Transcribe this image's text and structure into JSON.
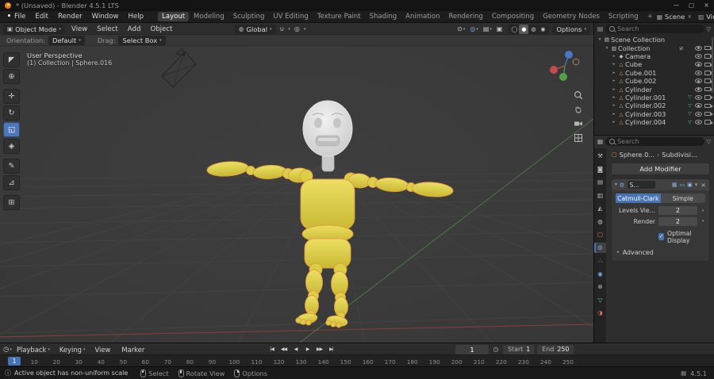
{
  "ui": {
    "dd": "▾"
  },
  "titlebar": {
    "title": "* (Unsaved) - Blender 4.5.1 LTS",
    "minimize": "—",
    "maximize": "▢",
    "close": "×"
  },
  "menus": [
    {
      "label": "File"
    },
    {
      "label": "Edit"
    },
    {
      "label": "Render"
    },
    {
      "label": "Window"
    },
    {
      "label": "Help"
    }
  ],
  "workspaces": [
    {
      "label": "Layout",
      "active": 1
    },
    {
      "label": "Modeling"
    },
    {
      "label": "Sculpting"
    },
    {
      "label": "UV Editing"
    },
    {
      "label": "Texture Paint"
    },
    {
      "label": "Shading"
    },
    {
      "label": "Animation"
    },
    {
      "label": "Rendering"
    },
    {
      "label": "Compositing"
    },
    {
      "label": "Geometry Nodes"
    },
    {
      "label": "Scripting"
    },
    {
      "label": "+",
      "add": 1
    }
  ],
  "scene_selector": {
    "scene_icon": "▦",
    "scene_label": "Scene",
    "viewlayer_icon": "▥",
    "viewlayer_label": "ViewLayer",
    "close": "×"
  },
  "viewhdr": {
    "mode_icon": "▣",
    "mode": "Object Mode",
    "menus": [
      {
        "label": "View"
      },
      {
        "label": "Select"
      },
      {
        "label": "Add"
      },
      {
        "label": "Object"
      }
    ],
    "orientation_icon": "◍",
    "orientation": "Global",
    "snap_icon": "∪",
    "prop_icon": "◎",
    "right_icons": [
      {
        "name": "visibility",
        "glyph": "⊙",
        "dd_glyph": "▾"
      },
      {
        "name": "gizmos",
        "glyph": "◎",
        "dd_glyph": "▾",
        "active": 1
      },
      {
        "name": "overlays",
        "glyph": "▤",
        "dd_glyph": "▾"
      },
      {
        "name": "xray",
        "glyph": "▣"
      }
    ],
    "shading": [
      {
        "name": "wireframe",
        "glyph": "◯"
      },
      {
        "name": "solid",
        "glyph": "●",
        "active": 1
      },
      {
        "name": "material-preview",
        "glyph": "◍"
      },
      {
        "name": "rendered",
        "glyph": "◉"
      }
    ],
    "options": "Options"
  },
  "toolstrip": {
    "orientation_label": "Orientation:",
    "orientation_value": "Default",
    "drag_label": "Drag:",
    "drag_value": "Select Box"
  },
  "viewport": {
    "overlay1": "User Perspective",
    "overlay2": "(1) Collection | Sphere.016",
    "tools": [
      {
        "name": "tweak-select-tool",
        "glyph": "◤"
      },
      {
        "name": "cursor-tool",
        "glyph": "⊕"
      },
      {
        "name": "move-tool",
        "glyph": "✛",
        "gap": 1
      },
      {
        "name": "rotate-tool",
        "glyph": "↻"
      },
      {
        "name": "scale-tool",
        "glyph": "◱",
        "active": 1
      },
      {
        "name": "transform-tool",
        "glyph": "◈"
      },
      {
        "name": "annotate-tool",
        "glyph": "✎",
        "gap": 1
      },
      {
        "name": "measure-tool",
        "glyph": "⊿"
      },
      {
        "name": "add-cube-tool",
        "glyph": "⊞",
        "gap": 1
      }
    ]
  },
  "outliner": {
    "mode_icon": "▤",
    "search_placeholder": "Search",
    "filter_icon": "▽",
    "rows": [
      {
        "name": "Scene Collection",
        "arrow": "▾",
        "icon_glyph": "▤",
        "icon_color": "#cfcfcf",
        "indent": 0,
        "hide_restrict": 1
      },
      {
        "name": "Collection",
        "arrow": "▾",
        "icon_glyph": "▥",
        "icon_color": "#cfcfcf",
        "indent": 1,
        "check": 1,
        "check_glyph": "✓"
      },
      {
        "name": "Camera",
        "arrow": "▸",
        "icon_glyph": "◆",
        "icon_color": "#b9b9b9",
        "indent": 2
      },
      {
        "name": "Cube",
        "arrow": "▸",
        "icon_glyph": "△",
        "icon_color": "#e09a5c",
        "indent": 2
      },
      {
        "name": "Cube.001",
        "arrow": "▸",
        "icon_glyph": "△",
        "icon_color": "#e09a5c",
        "indent": 2
      },
      {
        "name": "Cube.002",
        "arrow": "▸",
        "icon_glyph": "△",
        "icon_color": "#e09a5c",
        "indent": 2
      },
      {
        "name": "Cylinder",
        "arrow": "▸",
        "icon_glyph": "△",
        "icon_color": "#e09a5c",
        "indent": 2
      },
      {
        "name": "Cylinder.001",
        "arrow": "▸",
        "icon_glyph": "△",
        "icon_color": "#e09a5c",
        "indent": 2,
        "mod_glyph": "▽"
      },
      {
        "name": "Cylinder.002",
        "arrow": "▸",
        "icon_glyph": "△",
        "icon_color": "#e09a5c",
        "indent": 2,
        "mod_glyph": "▽"
      },
      {
        "name": "Cylinder.003",
        "arrow": "▸",
        "icon_glyph": "△",
        "icon_color": "#e09a5c",
        "indent": 2,
        "mod_glyph": "▽"
      },
      {
        "name": "Cylinder.004",
        "arrow": "▸",
        "icon_glyph": "△",
        "icon_color": "#e09a5c",
        "indent": 2,
        "mod_glyph": "▽"
      }
    ]
  },
  "properties": {
    "editor_icon": "▦",
    "search_placeholder": "Search",
    "filter_icon": "▽",
    "tabs": [
      {
        "name": "tool-tab",
        "glyph": "⚒",
        "color": "#bdbdbd"
      },
      {
        "name": "render-tab",
        "glyph": "◙",
        "color": "#bdbdbd"
      },
      {
        "name": "output-tab",
        "glyph": "▤",
        "color": "#bdbdbd"
      },
      {
        "name": "view-layer-tab",
        "glyph": "▥",
        "color": "#bdbdbd"
      },
      {
        "name": "scene-tab",
        "glyph": "◭",
        "color": "#bdbdbd"
      },
      {
        "name": "world-tab",
        "glyph": "◍",
        "color": "#bdbdbd"
      },
      {
        "name": "object-tab",
        "glyph": "▢",
        "color": "#e8873f"
      },
      {
        "name": "modifiers-tab",
        "glyph": "⚙",
        "color": "#79aede",
        "active": 1
      },
      {
        "name": "particles-tab",
        "glyph": "∴",
        "color": "#79aede"
      },
      {
        "name": "physics-tab",
        "glyph": "◉",
        "color": "#79aede"
      },
      {
        "name": "constraints-tab",
        "glyph": "⊗",
        "color": "#bdbdbd"
      },
      {
        "name": "object-data-tab",
        "glyph": "▽",
        "color": "#52c9a4"
      },
      {
        "name": "material-tab",
        "glyph": "◑",
        "color": "#e0736b"
      }
    ],
    "breadcrumb": {
      "object_icon": "▢",
      "object": "Sphere.0...",
      "sep": "›",
      "context": "Subdivisi..."
    },
    "add_modifier": "Add Modifier",
    "modifier": {
      "expand": "▾",
      "icon": "⚙",
      "name": "S...",
      "toggles": [
        {
          "name": "edit-mode-toggle",
          "glyph": "▦",
          "on": 1
        },
        {
          "name": "realtime-toggle",
          "glyph": "▭",
          "on": 1
        },
        {
          "name": "render-toggle",
          "glyph": "▣",
          "on": 1
        },
        {
          "name": "extras-dropdown",
          "glyph": "▾"
        }
      ],
      "close": "×",
      "types": [
        {
          "label": "Catmull-Clark",
          "active": 1
        },
        {
          "label": "Simple"
        }
      ],
      "rows": [
        {
          "label": "Levels Vie...",
          "value": "2"
        },
        {
          "label": "Render",
          "value": "2"
        }
      ],
      "dot": "•",
      "check_glyph": "✓",
      "optimal": "Optimal Display",
      "advanced_arrow": "▸",
      "advanced": "Advanced"
    }
  },
  "timeline": {
    "editor_icon": "◷",
    "menus": [
      {
        "label": "Playback",
        "arrow": "▾"
      },
      {
        "label": "Keying",
        "arrow": "▾"
      },
      {
        "label": "View"
      },
      {
        "label": "Marker"
      }
    ],
    "transport": [
      {
        "name": "jump-to-start-button",
        "glyph": "|◀"
      },
      {
        "name": "prev-keyframe-button",
        "glyph": "◀◀"
      },
      {
        "name": "play-reverse-button",
        "glyph": "◀"
      },
      {
        "name": "play-button",
        "glyph": "▶"
      },
      {
        "name": "next-keyframe-button",
        "glyph": "▶▶"
      },
      {
        "name": "jump-to-end-button",
        "glyph": "▶|"
      }
    ],
    "current_frame": "1",
    "preview_range_icon": "◷",
    "start_label": "Start",
    "start_value": "1",
    "end_label": "End",
    "end_value": "250",
    "playhead_label": "1",
    "ruler": [
      {
        "f": 10,
        "label": "10"
      },
      {
        "f": 20,
        "label": "20"
      },
      {
        "f": 30,
        "label": "30"
      },
      {
        "f": 40,
        "label": "40"
      },
      {
        "f": 50,
        "label": "50"
      },
      {
        "f": 60,
        "label": "60"
      },
      {
        "f": 70,
        "label": "70"
      },
      {
        "f": 80,
        "label": "80"
      },
      {
        "f": 90,
        "label": "90"
      },
      {
        "f": 100,
        "label": "100"
      },
      {
        "f": 110,
        "label": "110"
      },
      {
        "f": 120,
        "label": "120"
      },
      {
        "f": 130,
        "label": "130"
      },
      {
        "f": 140,
        "label": "140"
      },
      {
        "f": 150,
        "label": "150"
      },
      {
        "f": 160,
        "label": "160"
      },
      {
        "f": 170,
        "label": "170"
      },
      {
        "f": 180,
        "label": "180"
      },
      {
        "f": 190,
        "label": "190"
      },
      {
        "f": 200,
        "label": "200"
      },
      {
        "f": 210,
        "label": "210"
      },
      {
        "f": 220,
        "label": "220"
      },
      {
        "f": 230,
        "label": "230"
      },
      {
        "f": 240,
        "label": "240"
      },
      {
        "f": 250,
        "label": "250"
      }
    ]
  },
  "statusbar": {
    "warn_icon": "ⓘ",
    "message": "Active object has non-uniform scale",
    "hints": [
      {
        "label": "Select",
        "cls": "m-left"
      },
      {
        "label": "Rotate View",
        "cls": "m-mid"
      },
      {
        "label": "Options",
        "cls": "m-right"
      }
    ],
    "sys_icon": "▦",
    "version": "4.5.1"
  },
  "colors": {
    "accent": "#4772b3",
    "object_orange": "#e8873f",
    "selection_outline": "#e59a3e",
    "doll_yellow": "#d9c93f",
    "head_gray": "#d9d9d9",
    "axis_x_red": "#8f4040",
    "axis_y_green": "#4e7c45"
  }
}
